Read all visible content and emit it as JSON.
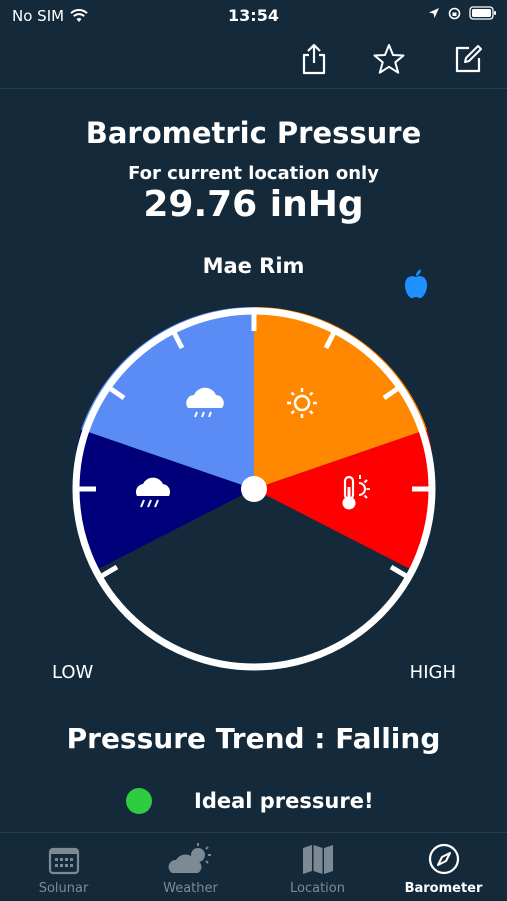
{
  "status": {
    "carrier": "No SIM",
    "time": "13:54"
  },
  "header": {
    "title": "Barometric Pressure",
    "subtitle": "For current location only",
    "reading": "29.76 inHg",
    "location": "Mae Rim"
  },
  "gauge": {
    "low_label": "LOW",
    "high_label": "HIGH",
    "segments": [
      {
        "name": "rain",
        "color": "#00007a",
        "icon": "rain-cloud-icon"
      },
      {
        "name": "showers",
        "color": "#5b8cf5",
        "icon": "showers-cloud-icon"
      },
      {
        "name": "sunny",
        "color": "#ff8800",
        "icon": "sun-icon"
      },
      {
        "name": "hot",
        "color": "#ff0000",
        "icon": "thermometer-sun-icon"
      }
    ]
  },
  "trend": {
    "label": "Pressure Trend :  Falling"
  },
  "status_message": {
    "text": "Ideal pressure!",
    "color": "#2ecc40"
  },
  "tabs": [
    {
      "label": "Solunar",
      "icon": "calendar-icon",
      "active": false
    },
    {
      "label": "Weather",
      "icon": "partly-cloudy-icon",
      "active": false
    },
    {
      "label": "Location",
      "icon": "map-icon",
      "active": false
    },
    {
      "label": "Barometer",
      "icon": "compass-icon",
      "active": true
    }
  ],
  "colors": {
    "background": "#142a3a",
    "accent": "#ffffff",
    "inactive": "#7c8a95"
  }
}
